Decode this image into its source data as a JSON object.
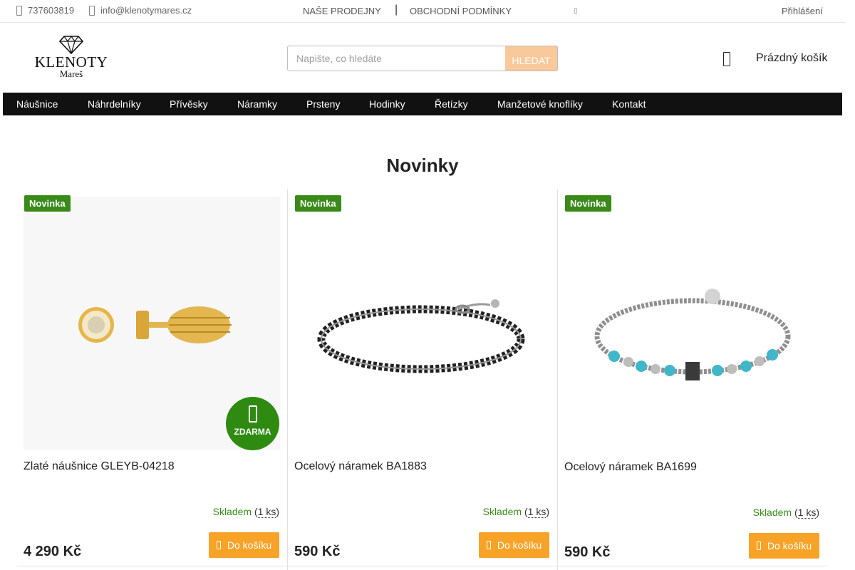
{
  "topbar": {
    "phone": "737603819",
    "email": "info@klenotymares.cz",
    "links": [
      "NAŠE PRODEJNY",
      "OBCHODNÍ PODMÍNKY"
    ],
    "separator": "|",
    "login": "Přihlášení"
  },
  "logo": {
    "name": "KLENOTY",
    "sub": "Mareš"
  },
  "search": {
    "placeholder": "Napište, co hledáte",
    "button": "HLEDAT"
  },
  "cart": {
    "label": "Prázdný košík"
  },
  "nav": {
    "items": [
      "Náušnice",
      "Náhrdelníky",
      "Přívěsky",
      "Náramky",
      "Prsteny",
      "Hodinky",
      "Řetízky",
      "Manžetové knoflíky",
      "Kontakt"
    ]
  },
  "section": {
    "title": "Novinky"
  },
  "products": [
    {
      "badge": "Novinka",
      "name": "Zlaté náušnice GLEYB-04218",
      "stock_label": "Skladem",
      "stock_count": "1 ks",
      "price": "4 290 Kč",
      "button": "Do košíku",
      "free_label": "ZDARMA",
      "image_icon": "gold-earrings-image"
    },
    {
      "badge": "Novinka",
      "name": "Ocelový náramek BA1883",
      "stock_label": "Skladem",
      "stock_count": "1 ks",
      "price": "590 Kč",
      "button": "Do košíku",
      "image_icon": "black-bead-bracelet-image"
    },
    {
      "badge": "Novinka",
      "name": "Ocelový náramek BA1699",
      "stock_label": "Skladem",
      "stock_count": "1 ks",
      "price": "590 Kč",
      "button": "Do košíku",
      "image_icon": "turquoise-bead-bracelet-image"
    }
  ],
  "colors": {
    "badge_green": "#3a8a1a",
    "button_orange": "#f7a328",
    "search_button": "#f9c99b",
    "nav_bg": "#111111"
  }
}
